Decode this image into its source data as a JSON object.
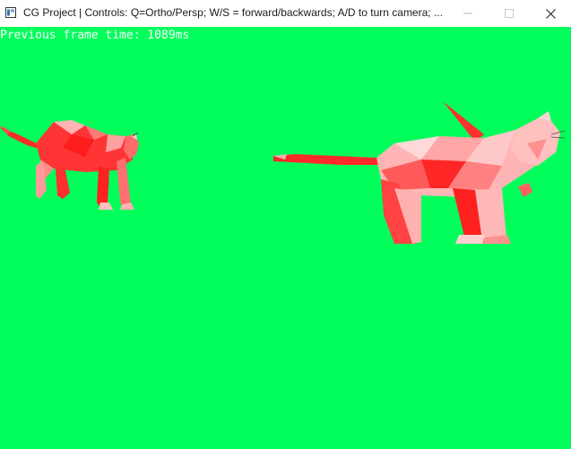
{
  "window": {
    "title": "CG Project | Controls: Q=Ortho/Persp; W/S = forward/backwards; A/D to turn camera; ...",
    "icon": "app-window-icon",
    "controls": {
      "minimize_icon": "minimize-icon",
      "maximize_icon": "maximize-icon",
      "close_icon": "close-icon"
    }
  },
  "viewport": {
    "background_color": "#00ff5a",
    "overlay_text": "Previous frame time: 1089ms",
    "objects": [
      {
        "name": "cat-model-left",
        "color": "#ff2a2a"
      },
      {
        "name": "cat-model-right",
        "color": "#ffb0b0"
      }
    ]
  }
}
